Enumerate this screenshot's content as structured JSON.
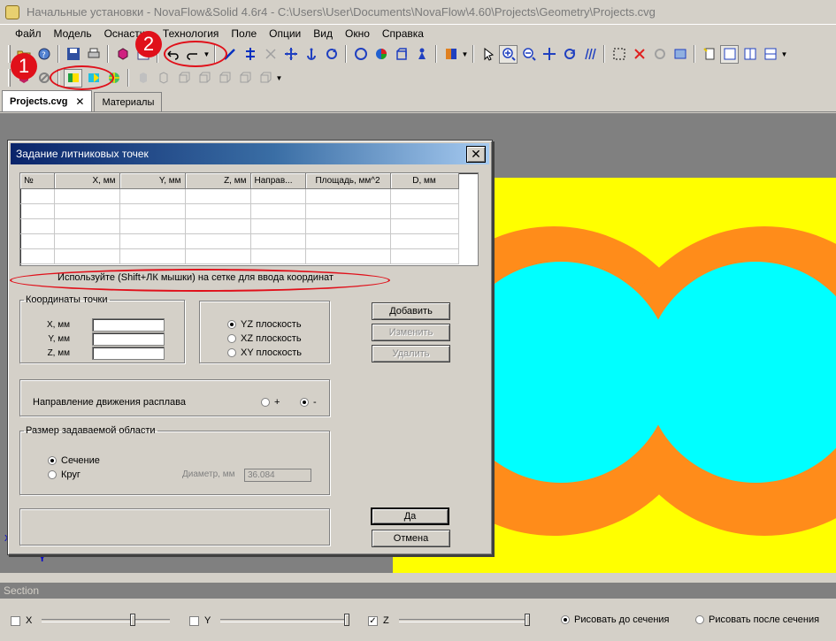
{
  "window": {
    "title": "Начальные установки - NovaFlow&Solid 4.6r4 - C:\\Users\\User\\Documents\\NovaFlow\\4.60\\Projects\\Geometry\\Projects.cvg"
  },
  "menu": {
    "items": [
      "Файл",
      "Модель",
      "Оснастка",
      "Технология",
      "Поле",
      "Опции",
      "Вид",
      "Окно",
      "Справка"
    ]
  },
  "tabs": [
    {
      "label": "Projects.cvg",
      "close": "✕"
    },
    {
      "label": "Материалы"
    }
  ],
  "dialog": {
    "title": "Задание литниковых точек",
    "close": "✕",
    "table": {
      "columns": [
        "№",
        "X, мм",
        "Y, мм",
        "Z, мм",
        "Направ...",
        "Площадь, мм^2",
        "D, мм"
      ]
    },
    "hint": "Используйте (Shift+ЛК мышки) на сетке для ввода координат",
    "coords_group": {
      "legend": "Координаты точки",
      "x_label": "X, мм",
      "y_label": "Y, мм",
      "z_label": "Z, мм",
      "x_value": "",
      "y_value": "",
      "z_value": ""
    },
    "planes": {
      "yz": "YZ плоскость",
      "xz": "XZ плоскость",
      "xy": "XY плоскость",
      "selected": "yz"
    },
    "buttons": {
      "add": "Добавить",
      "edit": "Изменить",
      "delete": "Удалить",
      "ok": "Да",
      "cancel": "Отмена"
    },
    "flow_direction": {
      "label": "Направление движения расплава",
      "plus": "+",
      "minus": "-",
      "selected": "minus"
    },
    "area_group": {
      "legend": "Размер задаваемой области",
      "section": "Сечение",
      "circle": "Круг",
      "selected": "section",
      "diameter_label": "Диаметр, мм",
      "diameter_value": "36.084"
    }
  },
  "workspace": {
    "axis_label": "Y",
    "axis_marker": "X",
    "colors": {
      "background": "#808080",
      "outer": "#ffff00",
      "ring": "#ff8c1a",
      "core": "#00ffff"
    }
  },
  "annotations": {
    "marker_1": "1",
    "marker_2": "2",
    "color": "#e0101a"
  },
  "section": {
    "header": "Section",
    "x_label": "X",
    "y_label": "Y",
    "z_label": "Z",
    "draw_before": "Рисовать до сечения",
    "draw_after": "Рисовать после сечения",
    "z_checked": "✓"
  }
}
